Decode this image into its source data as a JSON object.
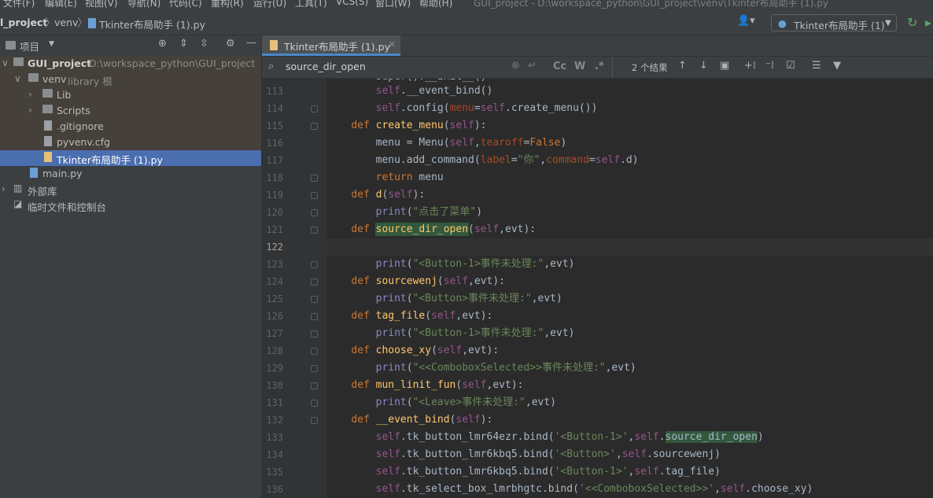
{
  "menubar": {
    "items": [
      "文件(F)",
      "编辑(E)",
      "视图(V)",
      "导航(N)",
      "代码(C)",
      "重构(R)",
      "运行(U)",
      "工具(T)",
      "VCS(S)",
      "窗口(W)",
      "帮助(H)"
    ],
    "window_title": "GUI_project - D:\\workspace_python\\GUI_project\\venv\\Tkinter布局助手 (1).py"
  },
  "breadcrumb": {
    "project": "l_project",
    "venv": "venv",
    "file": "Tkinter布局助手 (1).py"
  },
  "run_config": {
    "label": "Tkinter布局助手 (1)"
  },
  "sidebar": {
    "title": "项目",
    "tree": [
      {
        "label": "GUI_project",
        "hint": "D:\\workspace_python\\GUI_project"
      },
      {
        "label": "venv",
        "hint": "library 根"
      },
      {
        "label": "Lib"
      },
      {
        "label": "Scripts"
      },
      {
        "label": ".gitignore"
      },
      {
        "label": "pyvenv.cfg"
      },
      {
        "label": "Tkinter布局助手 (1).py"
      },
      {
        "label": "main.py"
      },
      {
        "label": "外部库"
      },
      {
        "label": "临时文件和控制台"
      }
    ]
  },
  "editor": {
    "tab_label": "Tkinter布局助手 (1).py",
    "find": {
      "query": "source_dir_open",
      "result_count": "2 个结果",
      "cc": "Cc",
      "w": "W",
      "regex": ".*"
    },
    "line_numbers": [
      "113",
      "114",
      "115",
      "116",
      "117",
      "118",
      "119",
      "120",
      "121",
      "122",
      "123",
      "124",
      "125",
      "126",
      "127",
      "128",
      "129",
      "130",
      "131",
      "132",
      "133",
      "134",
      "135",
      "136"
    ]
  },
  "colors": {
    "accent": "#4a88c7",
    "selection": "#4b6eaf",
    "match": "#32593d"
  }
}
